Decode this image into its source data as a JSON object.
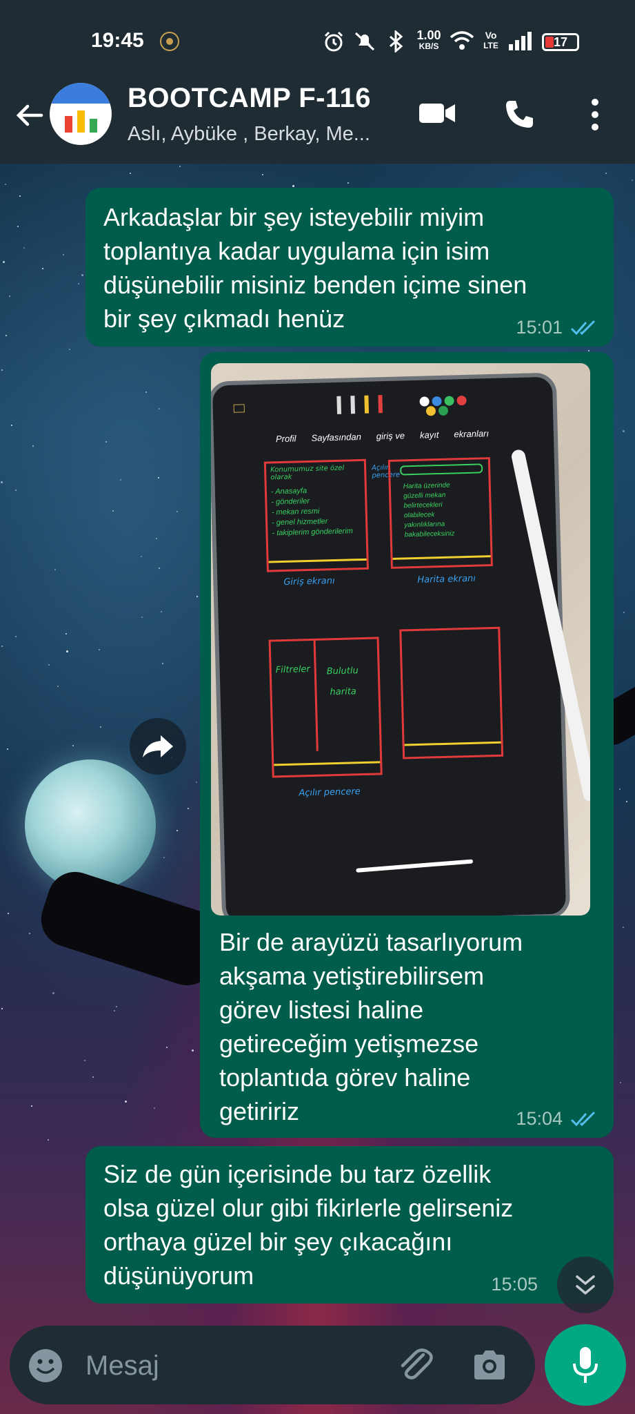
{
  "status_bar": {
    "time": "19:45",
    "net_speed_top": "1.00",
    "net_speed_bottom": "KB/S",
    "volte_top": "Vo",
    "volte_bottom": "LTE",
    "battery": "17"
  },
  "header": {
    "title": "BOOTCAMP F-116",
    "members": "Aslı, Aybüke , Berkay, Me..."
  },
  "messages": [
    {
      "text": "Arkadaşlar bir şey isteyebilir miyim\ntoplantıya kadar uygulama için isim\ndüşünebilir misiniz benden içime sinen\nbir şey çıkmadı henüz",
      "time": "15:01"
    },
    {
      "caption": "Bir de arayüzü tasarlıyorum\nakşama yetiştirebilirsem\ngörev listesi haline\ngetireceğim yetişmezse\ntoplantıda görev haline\ngetiririz",
      "time": "15:04",
      "sketch": {
        "toolbar_words": [
          "Profil",
          "Sayfasından",
          "giriş ve",
          "kayıt",
          "ekranları"
        ],
        "screen1_title": "Konumumuz site özel olarak",
        "screen1_items": [
          "- Anasayfa",
          "- gönderiler",
          "- mekan resmi",
          "- genel hizmetler",
          "- takiplerim gönderilerim"
        ],
        "screen1_label": "Giriş ekranı",
        "screen2_items": [
          "Harita üzerinde",
          "güzelli mekan",
          "belirtecekleri",
          "olabilecek",
          "yakınlıklarına",
          "bakabileceksiniz"
        ],
        "screen2_label": "Harita ekranı",
        "screen3_left": "Filtreler",
        "screen3_right_1": "Bulutlu",
        "screen3_right_2": "harita",
        "screen3_label": "Açılır pencere",
        "side_note": "Açılır pencere"
      }
    },
    {
      "text": "Siz de gün içerisinde bu tarz özellik\nolsa güzel olur gibi fikirlerle gelirseniz\northaya güzel bir şey çıkacağını\ndüşünüyorum",
      "time": "15:05"
    }
  ],
  "input": {
    "placeholder": "Mesaj"
  },
  "colors": {
    "bubble": "#005c4b",
    "bar": "#1f2c34",
    "accent": "#00a884",
    "tick": "#53bdeb"
  }
}
